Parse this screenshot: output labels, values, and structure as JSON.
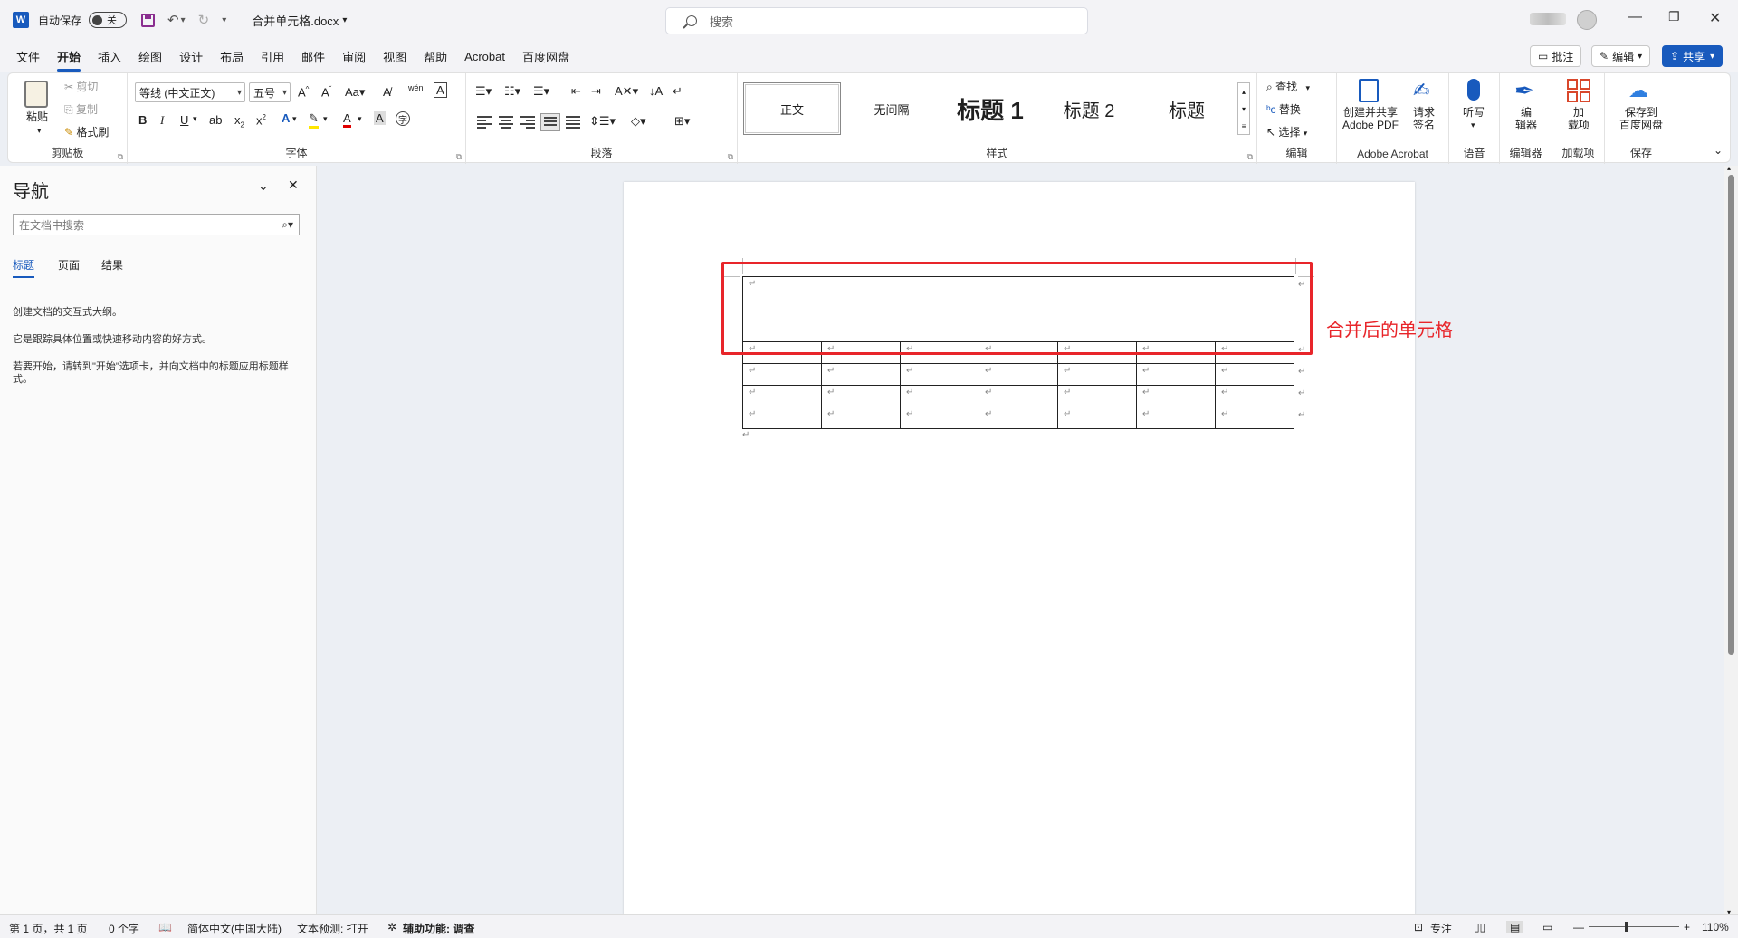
{
  "titlebar": {
    "app_icon_letter": "W",
    "autosave_label": "自动保存",
    "autosave_state": "关",
    "doc_title": "合并单元格.docx",
    "search_placeholder": "搜索"
  },
  "menu": {
    "tabs": [
      "文件",
      "开始",
      "插入",
      "绘图",
      "设计",
      "布局",
      "引用",
      "邮件",
      "审阅",
      "视图",
      "帮助",
      "Acrobat",
      "百度网盘"
    ],
    "active_tab": "开始",
    "comment_btn": "批注",
    "edit_btn": "编辑",
    "share_btn": "共享"
  },
  "ribbon": {
    "clipboard": {
      "paste": "粘贴",
      "cut": "剪切",
      "copy": "复制",
      "format_painter": "格式刷",
      "label": "剪贴板"
    },
    "font": {
      "font_name": "等线 (中文正文)",
      "font_size": "五号",
      "label": "字体"
    },
    "paragraph": {
      "label": "段落"
    },
    "styles": {
      "items": [
        "正文",
        "无间隔",
        "标题 1",
        "标题 2",
        "标题"
      ],
      "label": "样式"
    },
    "editing": {
      "find": "查找",
      "replace": "替换",
      "select": "选择",
      "label": "编辑"
    },
    "acrobat": {
      "create_share": "创建并共享",
      "create_share_line2": "Adobe PDF",
      "request_sign": "请求",
      "request_sign_line2": "签名",
      "label": "Adobe Acrobat"
    },
    "voice": {
      "dictate": "听写",
      "label": "语音"
    },
    "editor": {
      "editor_line1": "编",
      "editor_line2": "辑器",
      "label": "编辑器"
    },
    "addins": {
      "addins_line1": "加",
      "addins_line2": "载项",
      "label": "加载项"
    },
    "save": {
      "save_line1": "保存到",
      "save_line2": "百度网盘",
      "label": "保存"
    }
  },
  "nav": {
    "title": "导航",
    "search_placeholder": "在文档中搜索",
    "tabs": [
      "标题",
      "页面",
      "结果"
    ],
    "p1": "创建文档的交互式大纲。",
    "p2": "它是跟踪具体位置或快速移动内容的好方式。",
    "p3": "若要开始，请转到\"开始\"选项卡，并向文档中的标题应用标题样式。"
  },
  "document": {
    "columns": 7,
    "grid_rows": 4,
    "annotation": "合并后的单元格",
    "highlight_color": "#e8252a"
  },
  "statusbar": {
    "page": "第 1 页，共 1 页",
    "words": "0 个字",
    "language": "简体中文(中国大陆)",
    "text_prediction": "文本预测: 打开",
    "accessibility": "辅助功能: 调查",
    "focus": "专注",
    "zoom": "110%",
    "zoom_level": 0.42
  },
  "colors": {
    "accent": "#185abd",
    "annotation": "#e8252a"
  }
}
